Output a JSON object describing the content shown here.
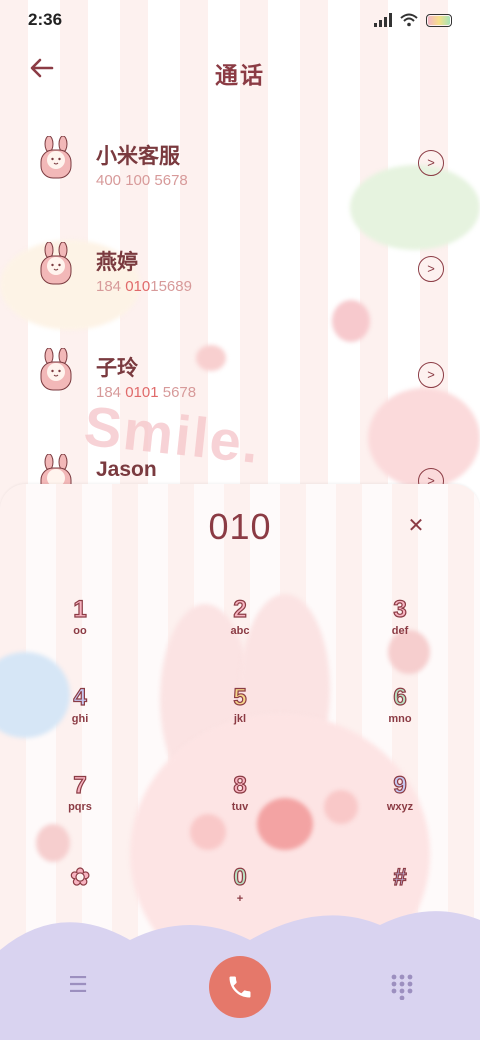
{
  "status": {
    "time": "2:36"
  },
  "header": {
    "title": "通话",
    "back_icon": "arrow-left-icon"
  },
  "contacts": [
    {
      "name": "小米客服",
      "number_pre": "",
      "number_hl": "",
      "number_post": "400 100 5678"
    },
    {
      "name": "燕婷",
      "number_pre": "184 ",
      "number_hl": "010",
      "number_post": "15689"
    },
    {
      "name": "子玲",
      "number_pre": "184 ",
      "number_hl": "0101",
      "number_post": " 5678"
    },
    {
      "name": "Jason",
      "number_pre": "",
      "number_hl": "",
      "number_post": ""
    }
  ],
  "decoration": {
    "smile": "Smile."
  },
  "dialer": {
    "number": "010",
    "clear_icon": "close-icon",
    "keys": [
      {
        "digit": "1",
        "letters": "ᴏᴏ"
      },
      {
        "digit": "2",
        "letters": "abc"
      },
      {
        "digit": "3",
        "letters": "def"
      },
      {
        "digit": "4",
        "letters": "ghi"
      },
      {
        "digit": "5",
        "letters": "jkl"
      },
      {
        "digit": "6",
        "letters": "mno"
      },
      {
        "digit": "7",
        "letters": "pqrs"
      },
      {
        "digit": "8",
        "letters": "tuv"
      },
      {
        "digit": "9",
        "letters": "wxyz"
      },
      {
        "digit": "✿",
        "letters": ""
      },
      {
        "digit": "0",
        "letters": "+"
      },
      {
        "digit": "#",
        "letters": ""
      }
    ],
    "menu_icon": "hamburger-menu-icon",
    "call_icon": "phone-icon",
    "dialpad_icon": "dialpad-icon"
  },
  "colors": {
    "accent": "#8b3b44",
    "call_button": "#e5786a",
    "number_highlight": "#e06a6a"
  }
}
